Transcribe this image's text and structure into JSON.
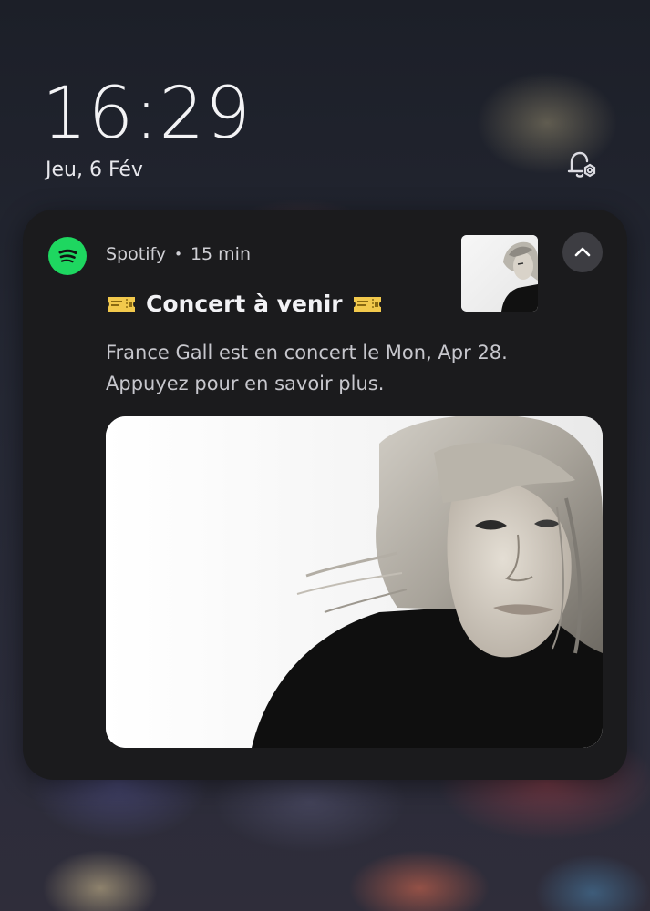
{
  "lockscreen": {
    "time": "16:29",
    "date": "Jeu, 6 Fév",
    "notification_settings_icon": "bell-settings-icon"
  },
  "notification": {
    "app_name": "Spotify",
    "elapsed": "15 min",
    "app_icon": "spotify-icon",
    "title": "Concert à venir",
    "title_emoji": "admission-ticket",
    "body": "France Gall est en concert le Mon, Apr 28. Appuyez pour en savoir plus.",
    "collapse_icon": "chevron-up-icon",
    "thumbnail": "artist-photo-thumbnail",
    "image": "artist-photo-large"
  },
  "colors": {
    "spotify_green": "#1ed760",
    "card_background": "#1b1b1d",
    "collapse_button_bg": "#3d3d42",
    "ticket_yellow": "#f2c94c"
  }
}
